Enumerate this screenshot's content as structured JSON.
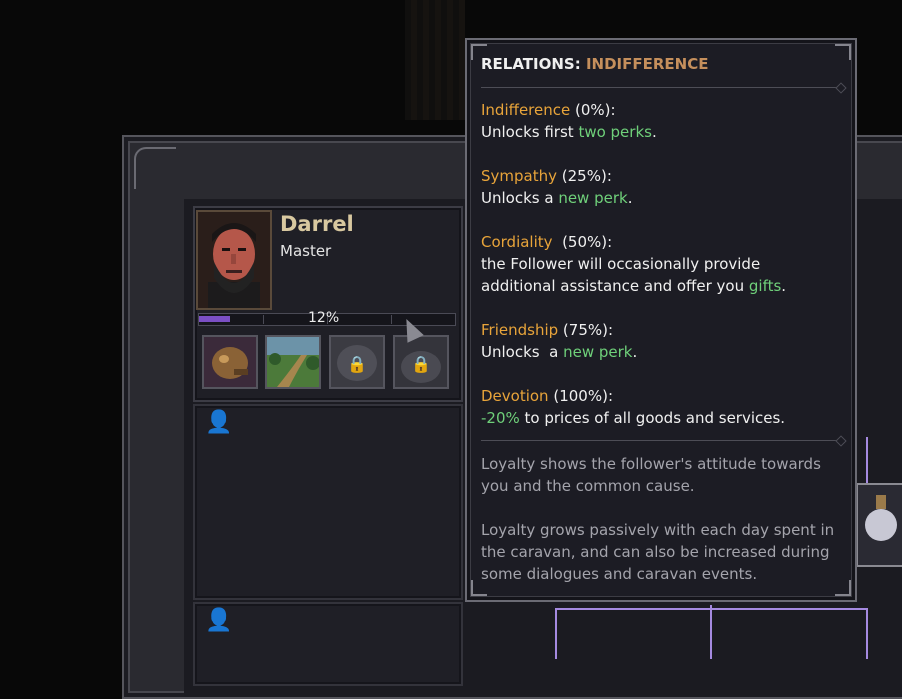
{
  "character": {
    "name": "Darrel",
    "title": "Master",
    "loyalty_percent": 12,
    "loyalty_text": "12%"
  },
  "perks": [
    {
      "name": "beast-perk-icon",
      "locked": false
    },
    {
      "name": "landscape-perk-icon",
      "locked": false
    },
    {
      "name": "locked-perk-icon",
      "locked": true
    },
    {
      "name": "locked-perk-icon",
      "locked": true
    }
  ],
  "tooltip": {
    "header_label": "RELATIONS:",
    "header_value": "INDIFFERENCE",
    "levels": [
      {
        "name": "Indifference",
        "pct": "(0%):",
        "line1_a": "Unlocks first ",
        "line1_hl": "two perks",
        "line1_b": "."
      },
      {
        "name": "Sympathy",
        "pct": "(25%):",
        "line1_a": "Unlocks a ",
        "line1_hl": "new perk",
        "line1_b": "."
      },
      {
        "name": "Cordiality",
        "pct": "(50%):",
        "line1": "the Follower will occasionally provide",
        "line2_a": "additional assistance and offer you ",
        "line2_hl": "gifts",
        "line2_b": "."
      },
      {
        "name": "Friendship",
        "pct": "(75%):",
        "line1_a": "Unlocks  a ",
        "line1_hl": "new perk",
        "line1_b": "."
      },
      {
        "name": "Devotion",
        "pct": "(100%):",
        "line1_hl": "-20%",
        "line1_b": " to prices of all goods and services."
      }
    ],
    "info1_line1": "Loyalty shows the follower's attitude towards",
    "info1_line2": "you and the common cause.",
    "info2_line1": "Loyalty grows passively with each day spent in",
    "info2_line2": "the caravan, and can also be increased during",
    "info2_line3": "some dialogues and caravan events."
  },
  "colors": {
    "accent_orange": "#e8a43a",
    "highlight_green": "#6fd07a",
    "loyalty_purple": "#7b4fc4"
  }
}
